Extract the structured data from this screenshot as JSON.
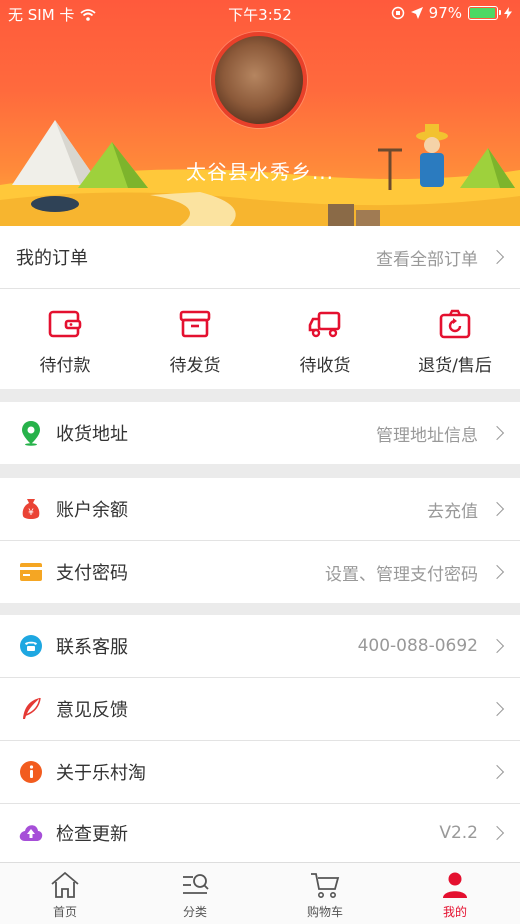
{
  "status_bar": {
    "carrier": "无 SIM 卡",
    "time": "下午3:52",
    "battery": "97%",
    "battery_level": 0.97
  },
  "profile": {
    "username": "太谷县水秀乡..."
  },
  "orders": {
    "title": "我的订单",
    "view_all": "查看全部订单",
    "items": [
      {
        "label": "待付款",
        "icon": "wallet-icon"
      },
      {
        "label": "待发货",
        "icon": "package-icon"
      },
      {
        "label": "待收货",
        "icon": "truck-icon"
      },
      {
        "label": "退货/售后",
        "icon": "return-icon"
      }
    ]
  },
  "address": {
    "label": "收货地址",
    "value": "管理地址信息"
  },
  "balance": {
    "label": "账户余额",
    "value": "去充值"
  },
  "pay_password": {
    "label": "支付密码",
    "value": "设置、管理支付密码"
  },
  "service": {
    "label": "联系客服",
    "value": "400-088-0692"
  },
  "feedback": {
    "label": "意见反馈"
  },
  "about": {
    "label": "关于乐村淘"
  },
  "update": {
    "label": "检查更新",
    "value": "V2.2"
  },
  "tabbar": {
    "items": [
      {
        "label": "首页",
        "icon": "home-icon"
      },
      {
        "label": "分类",
        "icon": "category-search-icon"
      },
      {
        "label": "购物车",
        "icon": "cart-icon"
      },
      {
        "label": "我的",
        "icon": "user-icon"
      }
    ],
    "active_color": "#e4102f"
  },
  "colors": {
    "accent": "#e4102f",
    "header_top": "#ff5a3c",
    "header_bottom": "#ffb13a"
  }
}
